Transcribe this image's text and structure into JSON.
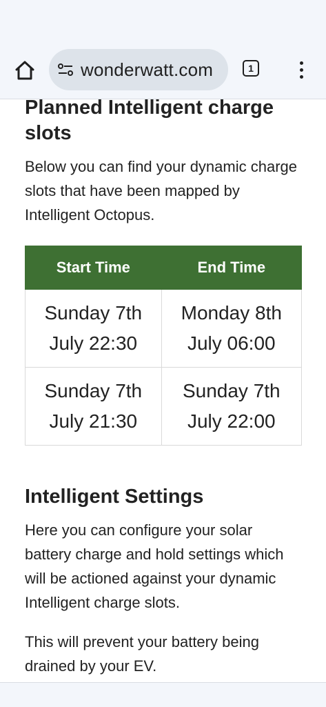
{
  "browser": {
    "url": "wonderwatt.com",
    "tab_count": "1"
  },
  "section1": {
    "title": "Planned Intelligent charge slots",
    "description": "Below you can find your dynamic charge slots that have been mapped by Intelligent Octopus."
  },
  "table": {
    "headers": [
      "Start Time",
      "End Time"
    ],
    "rows": [
      {
        "start": [
          "Sunday 7th",
          "July 22:30"
        ],
        "end": [
          "Monday 8th",
          "July 06:00"
        ]
      },
      {
        "start": [
          "Sunday 7th",
          "July 21:30"
        ],
        "end": [
          "Sunday 7th",
          "July 22:00"
        ]
      }
    ],
    "header_color": "#3e7033"
  },
  "section2": {
    "title": "Intelligent Settings",
    "paragraph1": "Here you can configure your solar battery charge and hold settings which will be actioned against your dynamic Intelligent charge slots.",
    "paragraph2": "This will prevent your battery being drained by your EV."
  },
  "icons": {
    "home": "home-icon",
    "site_settings": "site-settings-icon",
    "tabs": "tab-switcher-icon",
    "menu": "more-menu-icon"
  }
}
